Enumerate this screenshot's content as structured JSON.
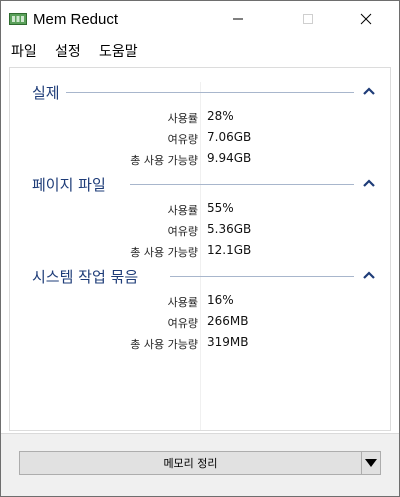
{
  "window": {
    "title": "Mem Reduct",
    "accent_color": "#1e3c78",
    "icon": "memory-chip-icon"
  },
  "menu": {
    "items": [
      {
        "label": "파일"
      },
      {
        "label": "설정"
      },
      {
        "label": "도움말"
      }
    ]
  },
  "groups": [
    {
      "title": "실제",
      "rows": [
        {
          "label": "사용률",
          "value": "28%"
        },
        {
          "label": "여유량",
          "value": "7.06GB"
        },
        {
          "label": "총 사용 가능량",
          "value": "9.94GB"
        }
      ]
    },
    {
      "title": "페이지 파일",
      "rows": [
        {
          "label": "사용률",
          "value": "55%"
        },
        {
          "label": "여유량",
          "value": "5.36GB"
        },
        {
          "label": "총 사용 가능량",
          "value": "12.1GB"
        }
      ]
    },
    {
      "title": "시스템 작업 묶음",
      "rows": [
        {
          "label": "사용률",
          "value": "16%"
        },
        {
          "label": "여유량",
          "value": "266MB"
        },
        {
          "label": "총 사용 가능량",
          "value": "319MB"
        }
      ]
    }
  ],
  "actions": {
    "clean_label": "메모리 정리",
    "dropdown_icon": "triangle-down-icon"
  }
}
